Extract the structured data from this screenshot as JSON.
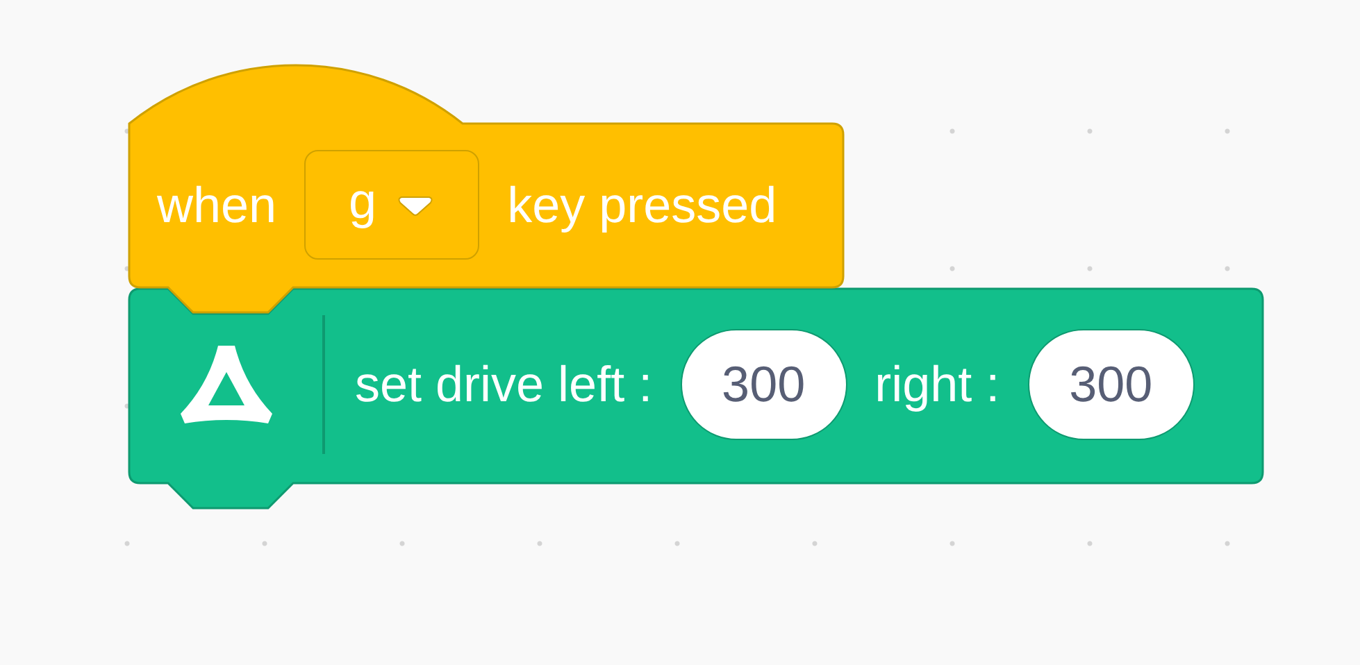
{
  "hat_block": {
    "label_before": "when",
    "key_dropdown": {
      "value": "g"
    },
    "label_after": "key pressed"
  },
  "command_block": {
    "label_left": "set drive left :",
    "left_input": "300",
    "label_right": "right :",
    "right_input": "300"
  }
}
